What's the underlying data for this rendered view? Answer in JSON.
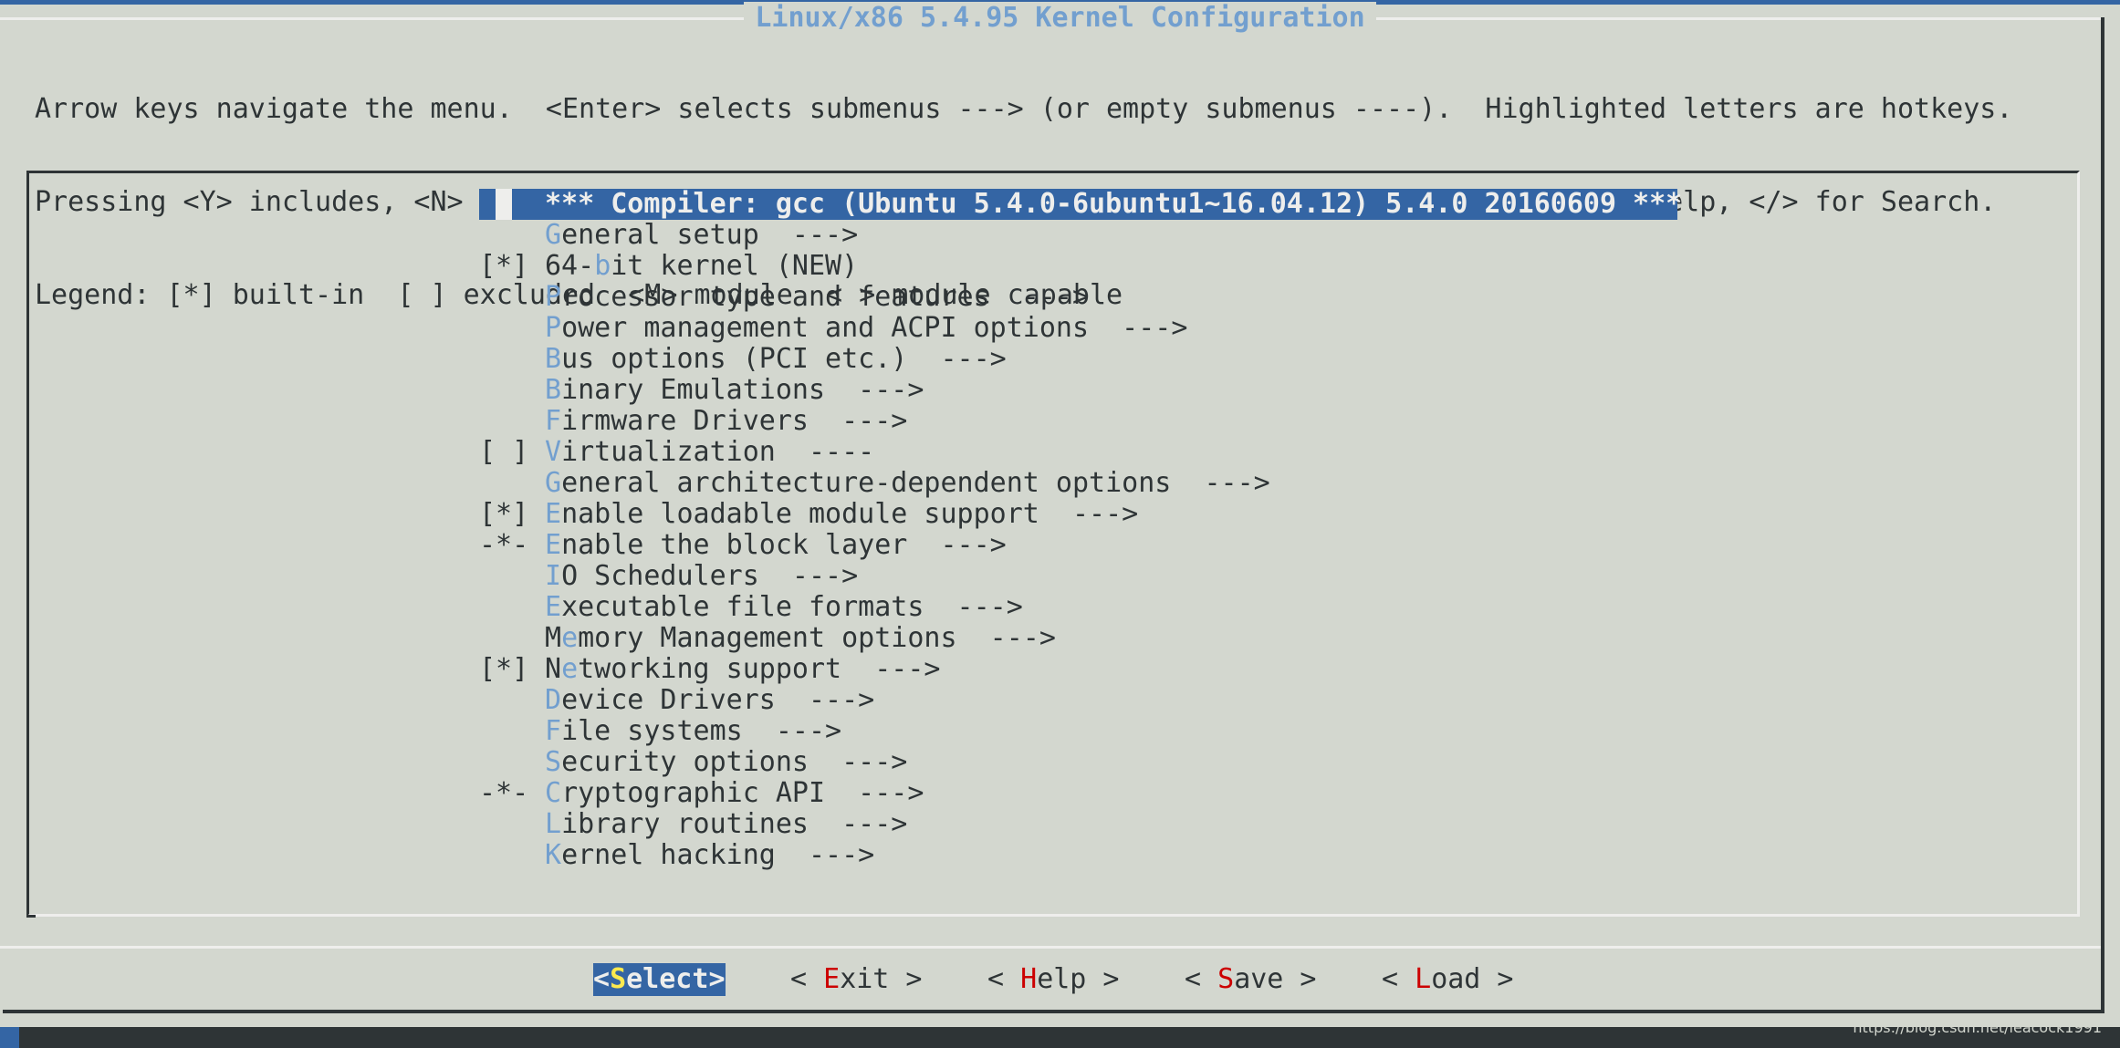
{
  "window": {
    "title": "Linux/x86 5.4.95 Kernel Configuration",
    "accent_color": "#3465a4",
    "hotkey_color": "#729fcf",
    "background_color": "#d3d7cf"
  },
  "help_text": [
    "Arrow keys navigate the menu.  <Enter> selects submenus ---> (or empty submenus ----).  Highlighted letters are hotkeys.",
    "Pressing <Y> includes, <N> excludes, <M> modularizes features.  Press <Esc><Esc> to exit, <?> for Help, </> for Search.",
    "Legend: [*] built-in  [ ] excluded  <M> module  < > module capable"
  ],
  "menu": {
    "selected_item": "*** Compiler: gcc (Ubuntu 5.4.0-6ubuntu1~16.04.12) 5.4.0 20160609 ***",
    "items": [
      {
        "mark": "",
        "pre": "",
        "hotkey": "G",
        "post": "eneral setup  --->"
      },
      {
        "mark": "[*]",
        "pre": "64-",
        "hotkey": "b",
        "post": "it kernel (NEW)"
      },
      {
        "mark": "",
        "pre": "",
        "hotkey": "P",
        "post": "rocessor type and features  --->"
      },
      {
        "mark": "",
        "pre": "",
        "hotkey": "P",
        "post": "ower management and ACPI options  --->"
      },
      {
        "mark": "",
        "pre": "",
        "hotkey": "B",
        "post": "us options (PCI etc.)  --->"
      },
      {
        "mark": "",
        "pre": "",
        "hotkey": "B",
        "post": "inary Emulations  --->"
      },
      {
        "mark": "",
        "pre": "",
        "hotkey": "F",
        "post": "irmware Drivers  --->"
      },
      {
        "mark": "[ ]",
        "pre": "",
        "hotkey": "V",
        "post": "irtualization  ----"
      },
      {
        "mark": "",
        "pre": "",
        "hotkey": "G",
        "post": "eneral architecture-dependent options  --->"
      },
      {
        "mark": "[*]",
        "pre": "",
        "hotkey": "E",
        "post": "nable loadable module support  --->"
      },
      {
        "mark": "-*-",
        "pre": "",
        "hotkey": "E",
        "post": "nable the block layer  --->"
      },
      {
        "mark": "",
        "pre": "",
        "hotkey": "I",
        "post": "O Schedulers  --->"
      },
      {
        "mark": "",
        "pre": "",
        "hotkey": "E",
        "post": "xecutable file formats  --->"
      },
      {
        "mark": "",
        "pre": "M",
        "hotkey": "e",
        "post": "mory Management options  --->"
      },
      {
        "mark": "[*]",
        "pre": "N",
        "hotkey": "e",
        "post": "tworking support  --->"
      },
      {
        "mark": "",
        "pre": "",
        "hotkey": "D",
        "post": "evice Drivers  --->"
      },
      {
        "mark": "",
        "pre": "",
        "hotkey": "F",
        "post": "ile systems  --->"
      },
      {
        "mark": "",
        "pre": "",
        "hotkey": "S",
        "post": "ecurity options  --->"
      },
      {
        "mark": "-*-",
        "pre": "",
        "hotkey": "C",
        "post": "ryptographic API  --->"
      },
      {
        "mark": "",
        "pre": "",
        "hotkey": "L",
        "post": "ibrary routines  --->"
      },
      {
        "mark": "",
        "pre": "",
        "hotkey": "K",
        "post": "ernel hacking  --->"
      }
    ]
  },
  "buttons": [
    {
      "left": "<",
      "hotkey": "S",
      "rest": "elect",
      "right": ">",
      "active": true
    },
    {
      "left": "< ",
      "hotkey": "E",
      "rest": "xit",
      "right": " >",
      "active": false
    },
    {
      "left": "< ",
      "hotkey": "H",
      "rest": "elp",
      "right": " >",
      "active": false
    },
    {
      "left": "< ",
      "hotkey": "S",
      "rest": "ave",
      "right": " >",
      "active": false
    },
    {
      "left": "< ",
      "hotkey": "L",
      "rest": "oad",
      "right": " >",
      "active": false
    }
  ],
  "watermark": "https://blog.csdn.net/leacock1991"
}
